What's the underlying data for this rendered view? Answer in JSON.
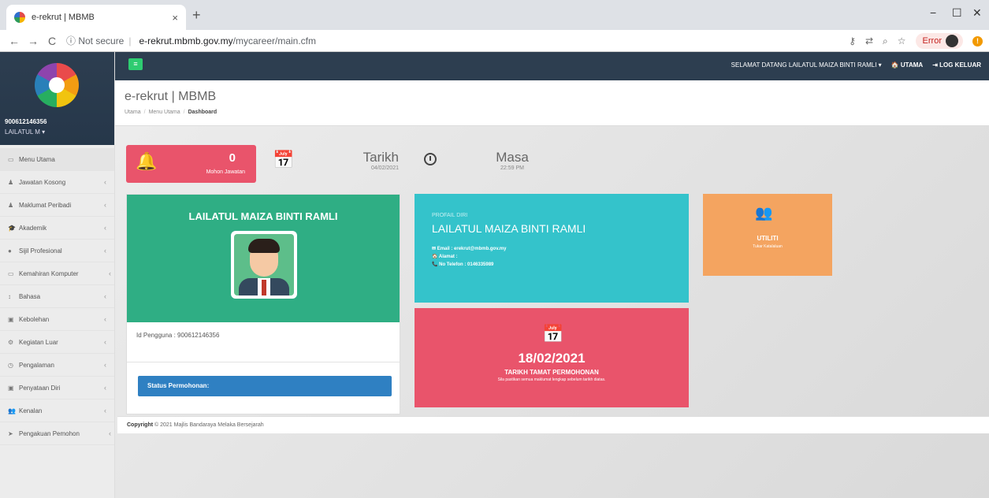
{
  "browser": {
    "tab_title": "e-rekrut | MBMB",
    "tab_close": "×",
    "new_tab": "+",
    "win_min": "−",
    "win_max": "☐",
    "win_close": "✕",
    "back": "←",
    "forward": "→",
    "reload": "C",
    "not_secure": "ⓘ Not secure",
    "url_host": "e-rekrut.mbmb.gov.my",
    "url_path": "/mycareer/main.cfm",
    "error_label": "Error"
  },
  "sidebar": {
    "user_id": "900612146356",
    "user_short": "LAILATUL M ▾",
    "items": [
      {
        "label": "Menu Utama",
        "icon": "▭"
      },
      {
        "label": "Jawatan Kosong",
        "icon": "♟"
      },
      {
        "label": "Maklumat Peribadi",
        "icon": "♟"
      },
      {
        "label": "Akademik",
        "icon": "🎓"
      },
      {
        "label": "Sijil Profesional",
        "icon": "●"
      },
      {
        "label": "Kemahiran Komputer",
        "icon": "▭"
      },
      {
        "label": "Bahasa",
        "icon": "↕"
      },
      {
        "label": "Kebolehan",
        "icon": "▣"
      },
      {
        "label": "Kegiatan Luar",
        "icon": "⚙"
      },
      {
        "label": "Pengalaman",
        "icon": "◷"
      },
      {
        "label": "Penyataan Diri",
        "icon": "▣"
      },
      {
        "label": "Kenalan",
        "icon": "👥"
      },
      {
        "label": "Pengakuan Pemohon",
        "icon": "➤"
      }
    ],
    "chevron": "‹"
  },
  "topbar": {
    "hamburger": "≡",
    "welcome": "SELAMAT DATANG  LAILATUL MAIZA BINTI RAMLI ▾",
    "home": "🏠 UTAMA",
    "logout": "⇥ LOG KELUAR"
  },
  "header": {
    "title": "e-rekrut | MBMB",
    "crumb_1": "Utama",
    "crumb_2": "Menu Utama",
    "crumb_3": "Dashboard",
    "sep": "/"
  },
  "stats": {
    "count": "0",
    "count_label": "Mohon Jawatan",
    "bell": "🔔",
    "calendar": "📅",
    "tarikh_label": "Tarikh",
    "tarikh_value": "04/02/2021",
    "masa_label": "Masa",
    "masa_value": "22:59 PM"
  },
  "profile": {
    "name": "LAILATUL MAIZA BINTI RAMLI",
    "user_id_line": "Id Pengguna : 900612146356",
    "status_btn": "Status Permohonan:"
  },
  "info": {
    "heading": "PROFAIL DIRI",
    "name": "LAILATUL MAIZA BINTI RAMLI",
    "email": "✉ Email : erekrut@mbmb.gov.my",
    "address": "🏠 Alamat :",
    "phone": "📞 No Telefon : 0146335989"
  },
  "deadline": {
    "icon": "📅",
    "date": "18/02/2021",
    "label": "TARIKH TAMAT PERMOHONAN",
    "note": "Sila pastikan semua maklumat lengkap sebelum tarikh diatas."
  },
  "utility": {
    "icon": "👥",
    "label": "UTILITI",
    "sub": "Tukar Katalaluan"
  },
  "footer": {
    "copyright": "Copyright",
    "text": "© 2021 Majlis Bandaraya Melaka Bersejarah"
  }
}
